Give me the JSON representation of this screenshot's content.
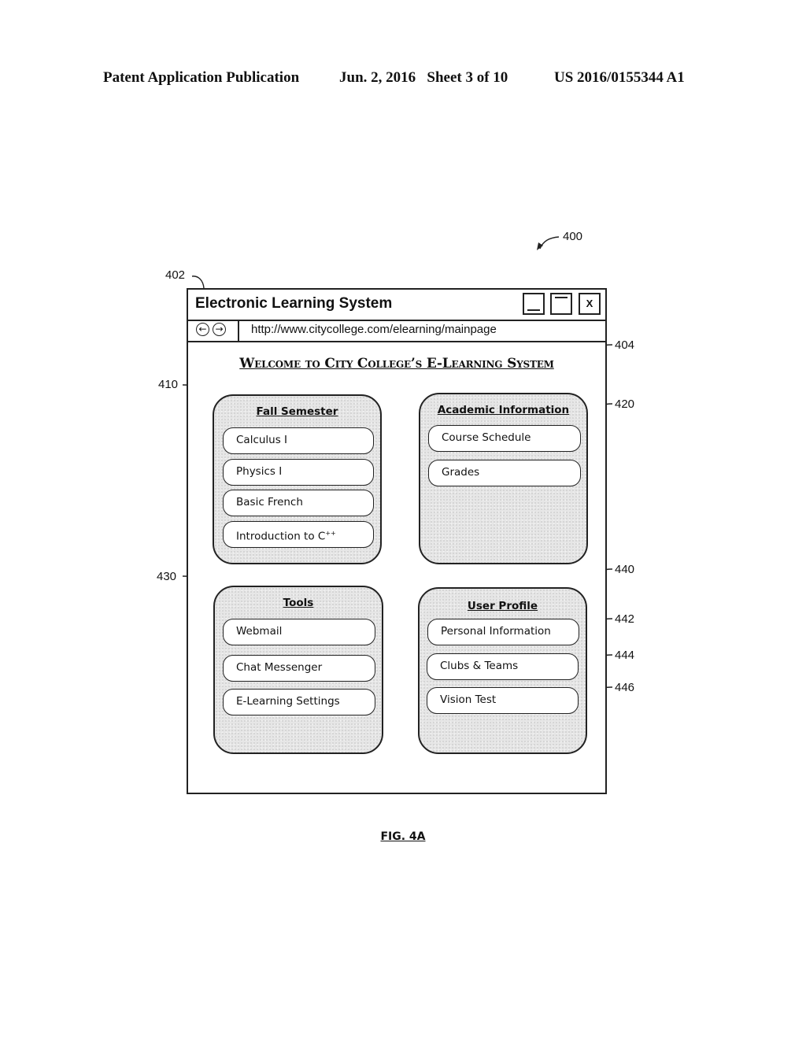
{
  "header": {
    "publication": "Patent Application Publication",
    "date_sheet": "Jun. 2, 2016   Sheet 3 of 10",
    "number": "US 2016/0155344 A1"
  },
  "reference_numerals": {
    "figure": "400",
    "window": "402",
    "welcome": "404",
    "fall_semester": "410",
    "academic_information": "420",
    "tools": "430",
    "user_profile": "440",
    "personal_information": "442",
    "clubs_teams": "444",
    "vision_test": "446"
  },
  "window": {
    "title": "Electronic Learning System",
    "controls": {
      "minimize_icon": "minimize-icon",
      "maximize_icon": "maximize-icon",
      "close_label": "X"
    },
    "nav": {
      "back_icon": "←",
      "forward_icon": "→"
    },
    "url": "http://www.citycollege.com/elearning/mainpage",
    "welcome": "Welcome to City College’s E-Learning System"
  },
  "panels": {
    "fall_semester": {
      "title": "Fall Semester",
      "items": [
        "Calculus I",
        "Physics I",
        "Basic French",
        "Introduction to C"
      ],
      "item4_superscript": "++"
    },
    "academic_information": {
      "title": "Academic Information",
      "items": [
        "Course Schedule",
        "Grades"
      ]
    },
    "tools": {
      "title": "Tools",
      "items": [
        "Webmail",
        "Chat Messenger",
        "E-Learning Settings"
      ]
    },
    "user_profile": {
      "title": "User Profile",
      "items": [
        "Personal Information",
        "Clubs & Teams",
        "Vision Test"
      ]
    }
  },
  "figure_label": "FIG. 4A"
}
